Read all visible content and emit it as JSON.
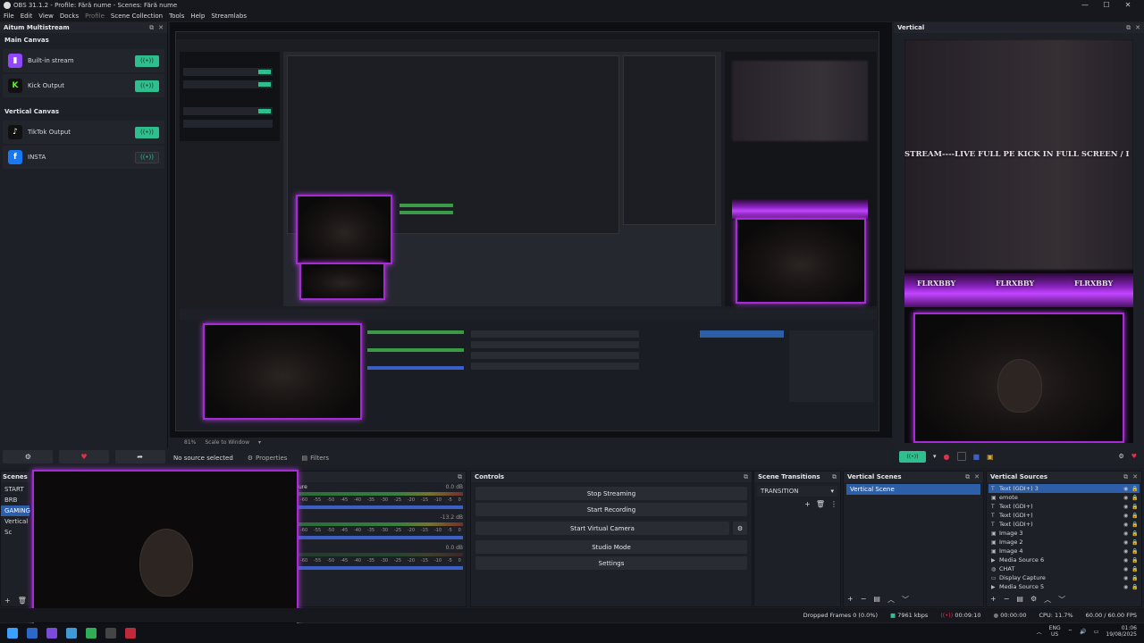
{
  "window": {
    "title": "OBS 31.1.2 - Profile: Fără nume - Scenes: Fără nume",
    "controls": [
      "—",
      "☐",
      "✕"
    ]
  },
  "menu": {
    "items": [
      "File",
      "Edit",
      "View",
      "Docks",
      "Profile",
      "Scene Collection",
      "Tools",
      "Help",
      "Streamlabs"
    ]
  },
  "multistream": {
    "title": "Aitum Multistream",
    "main_canvas_label": "Main Canvas",
    "vertical_canvas_label": "Vertical Canvas",
    "outputs_main": [
      {
        "name": "Built-in stream",
        "icon": "twitch-icon",
        "active": true
      },
      {
        "name": "Kick Output",
        "icon": "kick-icon",
        "active": true
      }
    ],
    "outputs_vertical": [
      {
        "name": "TikTok Output",
        "icon": "tiktok-icon",
        "active": true
      },
      {
        "name": "INSTA",
        "icon": "facebook-icon",
        "active": false
      }
    ]
  },
  "vertical": {
    "title": "Vertical",
    "overlay_text": "STREAM----LIVE FULL PE KICK IN FULL SCREEN / I",
    "handle": "FLRXBBY"
  },
  "preview_bar": {
    "no_source": "No source selected",
    "properties": "Properties",
    "filters": "Filters",
    "zoom": "81%",
    "scale_mode": "Scale to Window"
  },
  "scenes": {
    "title": "Scenes",
    "items": [
      "START",
      "BRB",
      "GAMING",
      "Vertical Sc"
    ],
    "selected": "GAMING"
  },
  "audio": {
    "label_fragment": "ure",
    "levels": [
      "0.0 dB",
      "-13.2 dB",
      "0.0 dB"
    ],
    "ticks": [
      "-60",
      "-55",
      "-50",
      "-45",
      "-40",
      "-35",
      "-30",
      "-25",
      "-20",
      "-15",
      "-10",
      "-5",
      "0"
    ]
  },
  "controls": {
    "title": "Controls",
    "stop_streaming": "Stop Streaming",
    "start_recording": "Start Recording",
    "start_virtual_camera": "Start Virtual Camera",
    "studio_mode": "Studio Mode",
    "settings": "Settings"
  },
  "scene_transitions": {
    "title": "Scene Transitions",
    "selected": "TRANSITION"
  },
  "vertical_scenes": {
    "title": "Vertical Scenes",
    "items": [
      "Vertical Scene"
    ]
  },
  "vertical_sources": {
    "title": "Vertical Sources",
    "items": [
      {
        "name": "Text (GDI+) 3",
        "selected": true
      },
      {
        "name": "emote"
      },
      {
        "name": "Text (GDI+)"
      },
      {
        "name": "Text (GDI+)"
      },
      {
        "name": "Text (GDI+)"
      },
      {
        "name": "Image 3"
      },
      {
        "name": "Image 2"
      },
      {
        "name": "Image 4"
      },
      {
        "name": "Media Source 6"
      },
      {
        "name": "CHAT"
      },
      {
        "name": "Display Capture"
      },
      {
        "name": "Media Source 5"
      }
    ]
  },
  "status": {
    "dropped_frames": "Dropped Frames 0 (0.0%)",
    "bitrate": "7961 kbps",
    "stream_time": "00:09:10",
    "rec_time": "00:00:00",
    "cpu": "CPU: 11.7%",
    "fps": "60.00 / 60.00 FPS"
  },
  "taskbar": {
    "lang": "ENG",
    "region": "US",
    "time": "01:06",
    "date": "19/08/2025"
  },
  "colors": {
    "accent_green": "#2fbf8e",
    "selection_blue": "#2d5ea8",
    "neon_purple": "#b53ce0",
    "twitch": "#9146ff",
    "kick": "#53fc18",
    "facebook": "#1877f2"
  }
}
